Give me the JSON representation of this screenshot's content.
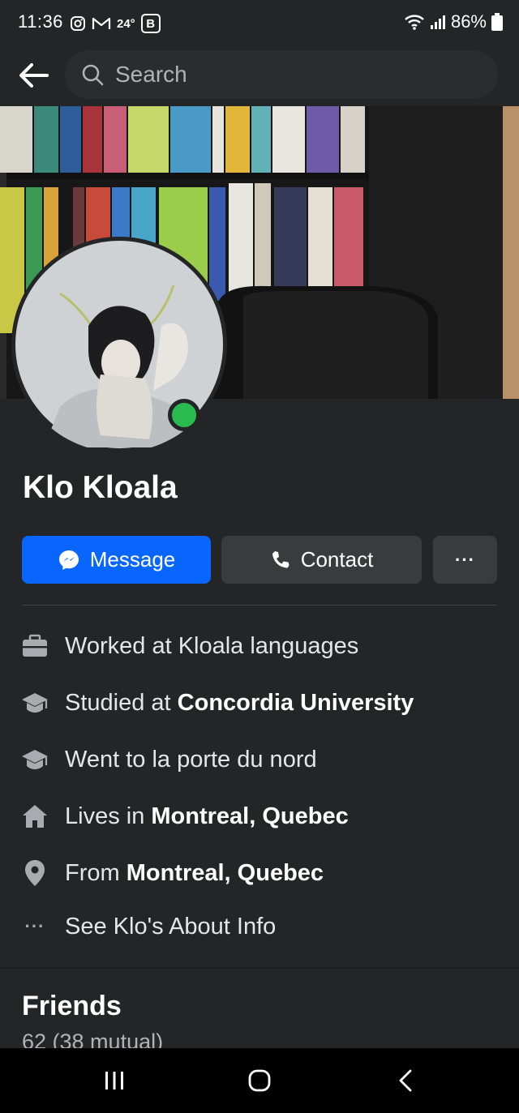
{
  "status_bar": {
    "time": "11:36",
    "temperature": "24°",
    "battery": "86%",
    "icons": [
      "instagram-icon",
      "gmail-icon",
      "b-badge-icon",
      "wifi-icon",
      "signal-icon",
      "battery-icon"
    ]
  },
  "search": {
    "placeholder": "Search"
  },
  "profile": {
    "name": "Klo Kloala",
    "online_status_color": "#2abb4f"
  },
  "actions": {
    "message_label": "Message",
    "contact_label": "Contact",
    "more_label": "···"
  },
  "about": {
    "work": {
      "prefix": "Worked at Kloala languages",
      "bold": ""
    },
    "study": {
      "prefix": "Studied at ",
      "bold": "Concordia University"
    },
    "school": {
      "prefix": "Went to la porte du nord",
      "bold": ""
    },
    "lives": {
      "prefix": "Lives in ",
      "bold": "Montreal, Quebec"
    },
    "from": {
      "prefix": "From ",
      "bold": "Montreal, Quebec"
    },
    "see_more": "See Klo's About Info",
    "more_icon": "···"
  },
  "friends": {
    "title": "Friends",
    "count": "62 (38 mutual)"
  },
  "colors": {
    "background": "#242526",
    "accent": "#0866ff",
    "button_secondary": "#3a3b3c"
  }
}
